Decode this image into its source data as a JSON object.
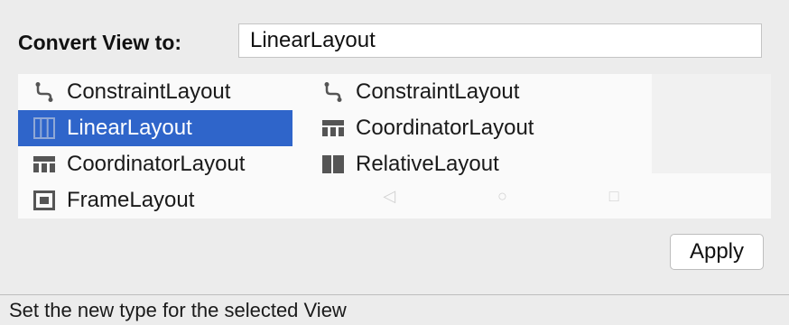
{
  "dialog": {
    "convert_label": "Convert View to:",
    "input_value": "LinearLayout",
    "apply_label": "Apply"
  },
  "list": {
    "left": [
      {
        "label": "ConstraintLayout",
        "icon": "constraint-layout-icon",
        "selected": false
      },
      {
        "label": "LinearLayout",
        "icon": "linear-layout-icon",
        "selected": true
      },
      {
        "label": "CoordinatorLayout",
        "icon": "coordinator-layout-icon",
        "selected": false
      },
      {
        "label": "FrameLayout",
        "icon": "frame-layout-icon",
        "selected": false
      }
    ],
    "right": [
      {
        "label": "ConstraintLayout",
        "icon": "constraint-layout-icon"
      },
      {
        "label": "CoordinatorLayout",
        "icon": "coordinator-layout-icon"
      },
      {
        "label": "RelativeLayout",
        "icon": "relative-layout-icon"
      }
    ]
  },
  "status": {
    "text": "Set the new type for the selected View"
  },
  "colors": {
    "selected_bg": "#2f65ca",
    "icon_gray": "#555555"
  }
}
